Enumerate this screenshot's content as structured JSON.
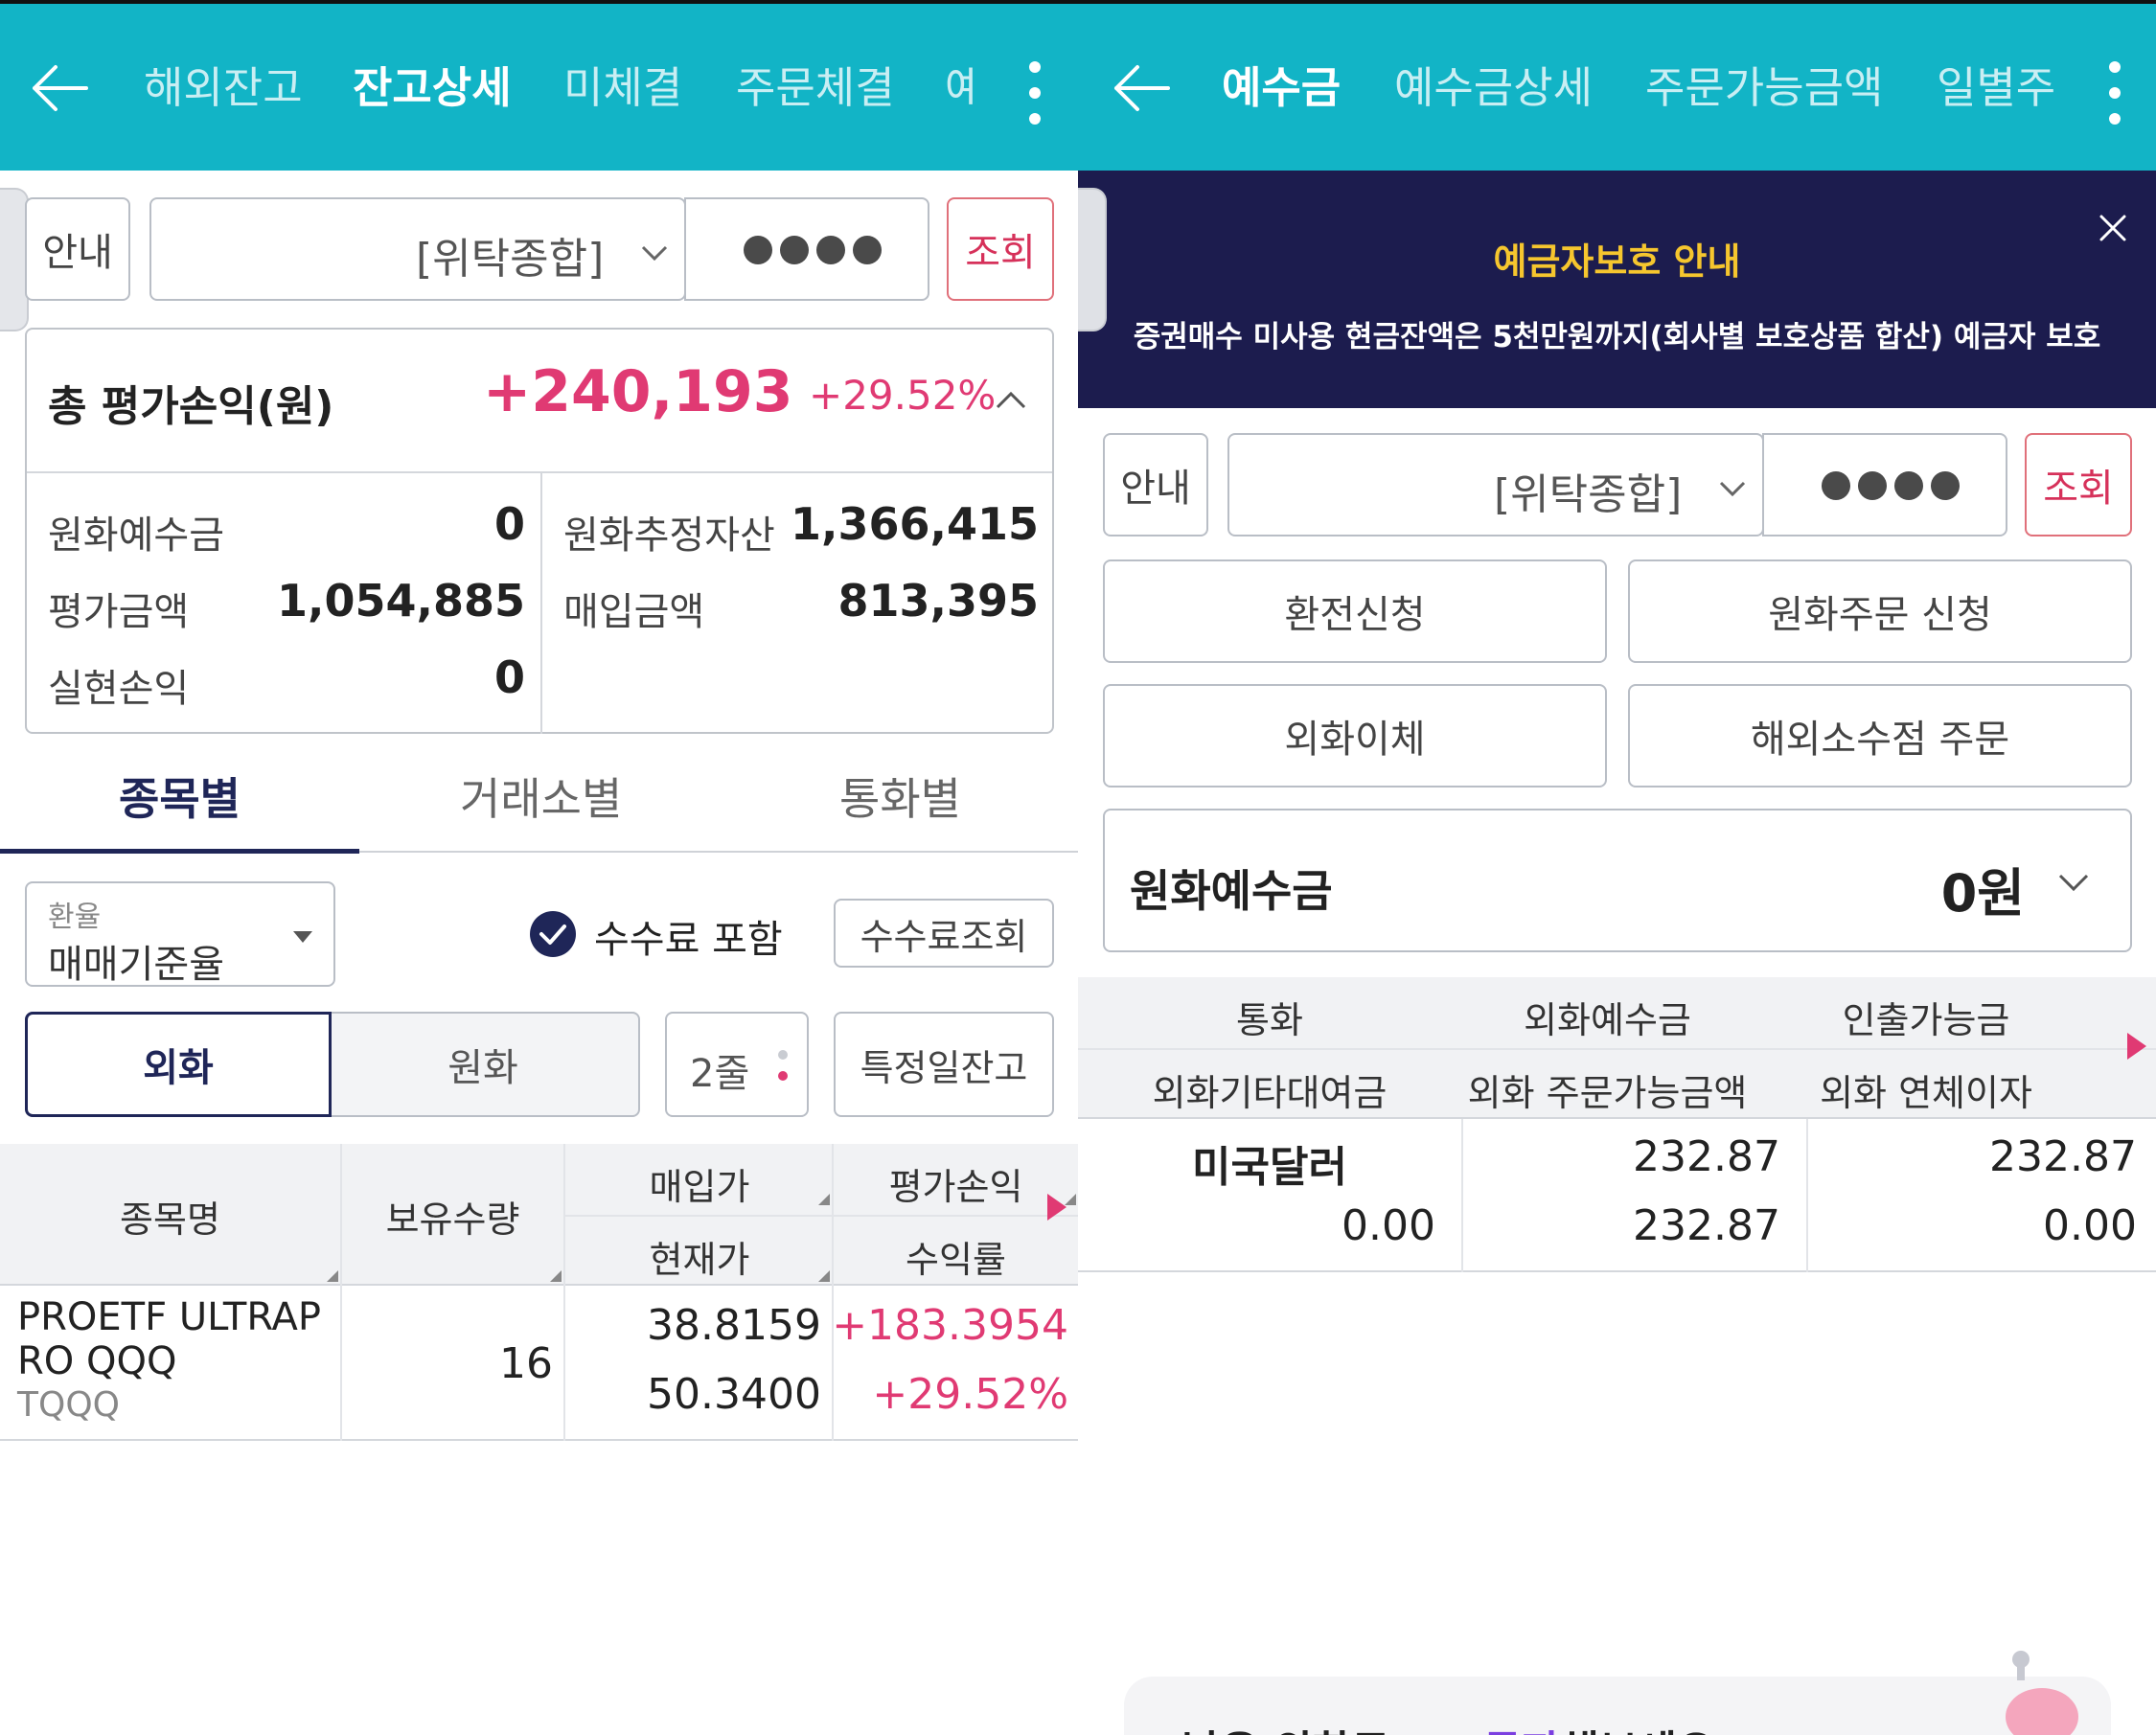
{
  "left": {
    "nav": {
      "tabs": [
        {
          "label": "해외잔고"
        },
        {
          "label": "잔고상세"
        },
        {
          "label": "미체결"
        },
        {
          "label": "주문체결"
        },
        {
          "label": "예"
        }
      ]
    },
    "account": {
      "info_label": "안내",
      "account_type": "[위탁종합]",
      "password_mask": "●●●●",
      "query_label": "조회"
    },
    "summary": {
      "title": "총 평가손익(원)",
      "total_pl": "+240,193",
      "total_pct": "+29.52%",
      "items": [
        {
          "label": "원화예수금",
          "value": "0"
        },
        {
          "label": "원화추정자산",
          "value": "1,366,415"
        },
        {
          "label": "평가금액",
          "value": "1,054,885"
        },
        {
          "label": "매입금액",
          "value": "813,395"
        },
        {
          "label": "실현손익",
          "value": "0"
        }
      ]
    },
    "view_tabs": [
      {
        "label": "종목별"
      },
      {
        "label": "거래소별"
      },
      {
        "label": "통화별"
      }
    ],
    "exchange_rate": {
      "label": "환율",
      "value": "매매기준율"
    },
    "fee_include_label": "수수료 포함",
    "fee_query_label": "수수료조회",
    "currency_toggle": {
      "foreign": "외화",
      "krw": "원화"
    },
    "rows_label": "2줄",
    "specific_date_label": "특정일잔고",
    "table": {
      "headers": {
        "name": "종목명",
        "quantity": "보유수량",
        "buy_price": "매입가",
        "current_price": "현재가",
        "pl": "평가손익",
        "return": "수익률"
      },
      "rows": [
        {
          "name_line1": "PROETF ULTRAP",
          "name_line2": "RO QQQ",
          "ticker": "TQQQ",
          "quantity": "16",
          "buy_price": "38.8159",
          "current_price": "50.3400",
          "pl": "+183.3954",
          "return": "+29.52%"
        }
      ]
    }
  },
  "right": {
    "nav": {
      "tabs": [
        {
          "label": "예수금"
        },
        {
          "label": "예수금상세"
        },
        {
          "label": "주문가능금액"
        },
        {
          "label": "일별주"
        }
      ]
    },
    "notice": {
      "title": "예금자보호 안내",
      "body": "증권매수 미사용 현금잔액은 5천만원까지(회사별 보호상품 합산) 예금자 보호"
    },
    "account": {
      "info_label": "안내",
      "account_type": "[위탁종합]",
      "password_mask": "●●●●",
      "query_label": "조회"
    },
    "actions": [
      {
        "label": "환전신청"
      },
      {
        "label": "원화주문 신청"
      },
      {
        "label": "외화이체"
      },
      {
        "label": "해외소수점 주문"
      }
    ],
    "krw_deposit": {
      "label": "원화예수금",
      "value": "0원"
    },
    "fx_table": {
      "headers": {
        "currency": "통화",
        "fx_deposit": "외화예수금",
        "withdrawable": "인출가능금",
        "fx_other_loan": "외화기타대여금",
        "fx_orderable": "외화 주문가능금액",
        "fx_overdue_interest": "외화 연체이자"
      },
      "rows": [
        {
          "currency": "미국달러",
          "fx_other_loan": "0.00",
          "fx_deposit": "232.87",
          "fx_orderable": "232.87",
          "withdrawable": "232.87",
          "fx_overdue_interest": "0.00"
        }
      ]
    },
    "promo": {
      "text_prefix": "남은 외화로 ",
      "text_link": "RP 투자",
      "text_suffix": "해보세요!"
    }
  },
  "colors": {
    "header_bg": "#12b4c6",
    "accent_pink": "#e03a73",
    "navy": "#1f2658",
    "notice_bg": "#1c1c4e",
    "notice_title": "#f6c62e"
  }
}
